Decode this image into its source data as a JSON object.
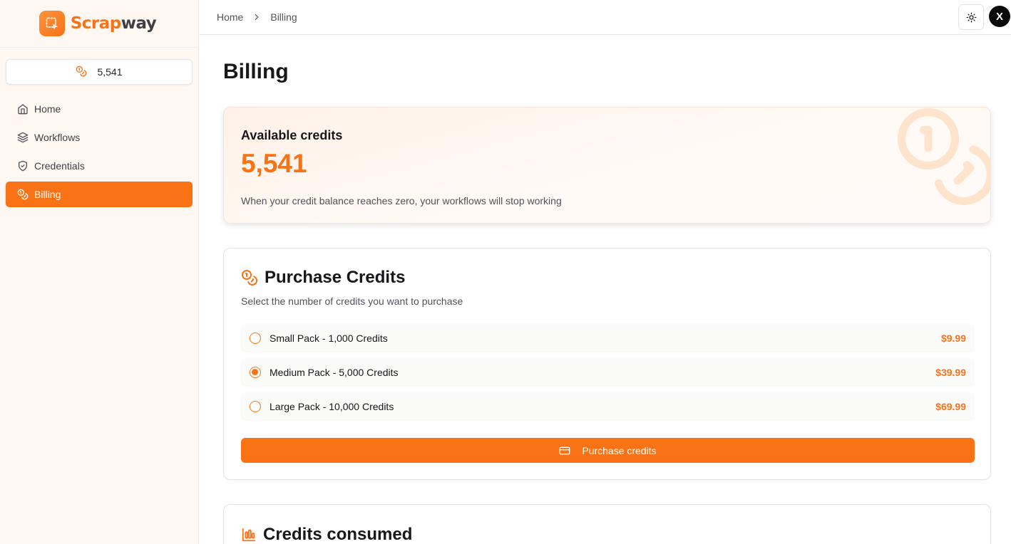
{
  "app": {
    "name_part1": "Scrap",
    "name_part2": "way",
    "brand_color": "#f97316"
  },
  "sidebar": {
    "credits": "5,541",
    "items": [
      {
        "label": "Home",
        "icon": "home-icon",
        "active": false
      },
      {
        "label": "Workflows",
        "icon": "layers-icon",
        "active": false
      },
      {
        "label": "Credentials",
        "icon": "shield-check-icon",
        "active": false
      },
      {
        "label": "Billing",
        "icon": "coins-icon",
        "active": true
      }
    ]
  },
  "header": {
    "breadcrumb": [
      "Home",
      "Billing"
    ],
    "avatar_initial": "X"
  },
  "page": {
    "title": "Billing"
  },
  "available": {
    "label": "Available credits",
    "value": "5,541",
    "note": "When your credit balance reaches zero, your workflows will stop working"
  },
  "purchase": {
    "title": "Purchase Credits",
    "subtitle": "Select the number of credits you want to purchase",
    "options": [
      {
        "label": "Small Pack - 1,000 Credits",
        "price": "$9.99",
        "selected": false
      },
      {
        "label": "Medium Pack - 5,000 Credits",
        "price": "$39.99",
        "selected": true
      },
      {
        "label": "Large Pack - 10,000 Credits",
        "price": "$69.99",
        "selected": false
      }
    ],
    "button_label": "Purchase credits"
  },
  "consumed": {
    "title": "Credits consumed"
  }
}
